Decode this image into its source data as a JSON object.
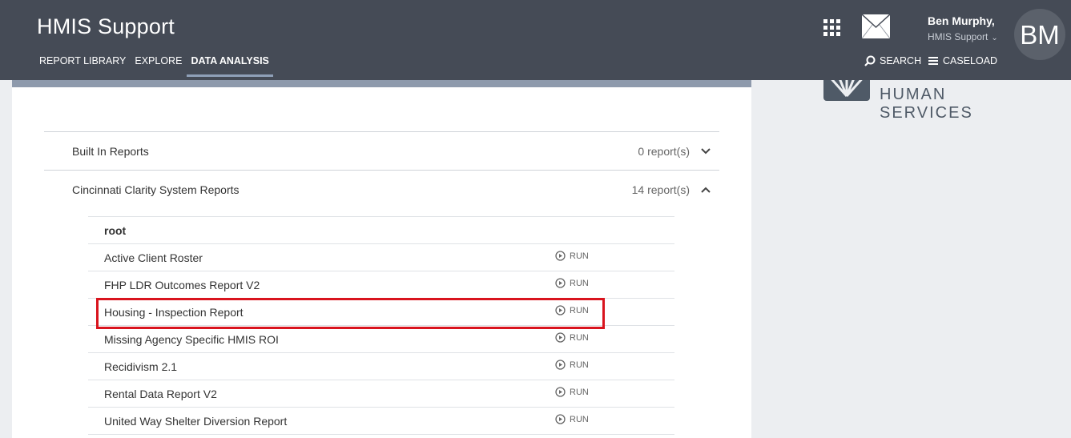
{
  "header": {
    "app_title": "HMIS Support",
    "nav": [
      {
        "label": "REPORT LIBRARY",
        "active": false
      },
      {
        "label": "EXPLORE",
        "active": false
      },
      {
        "label": "DATA ANALYSIS",
        "active": true
      }
    ],
    "user": {
      "name": "Ben Murphy,",
      "agency": "HMIS Support",
      "initials": "BM"
    },
    "search_label": "SEARCH",
    "caseload_label": "CASELOAD"
  },
  "logo": {
    "text": "HUMAN SERVICES"
  },
  "sections": [
    {
      "title": "Built In Reports",
      "count": "0 report(s)",
      "expanded": false
    },
    {
      "title": "Cincinnati Clarity System Reports",
      "count": "14 report(s)",
      "expanded": true
    }
  ],
  "reports": {
    "folder": "root",
    "run_label": "RUN",
    "items": [
      "Active Client Roster",
      "FHP LDR Outcomes Report V2",
      "Housing - Inspection Report",
      "Missing Agency Specific HMIS ROI",
      "Recidivism 2.1",
      "Rental Data Report V2",
      "United Way Shelter Diversion Report"
    ],
    "highlighted": "Housing - Inspection Report"
  },
  "colors": {
    "header_bg": "#454b56",
    "highlight_border": "#d9141e",
    "page_bg": "#eceef1"
  }
}
